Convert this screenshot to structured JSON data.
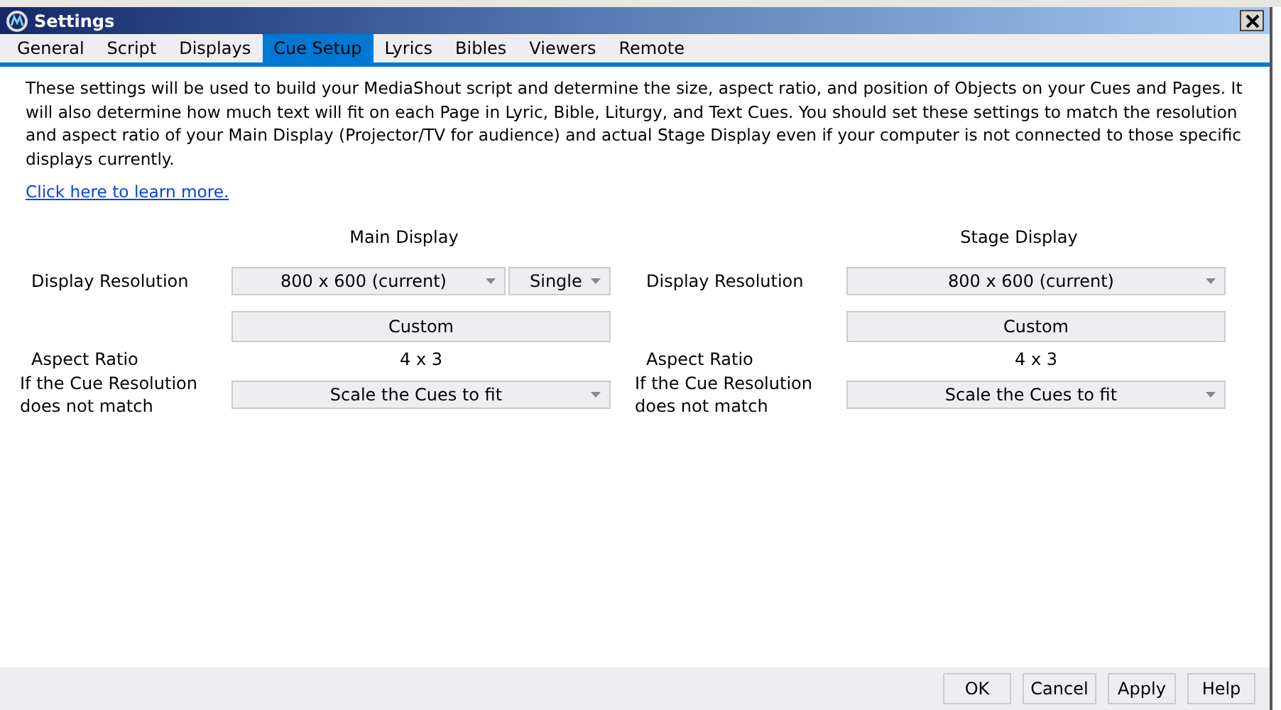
{
  "window": {
    "title": "Settings"
  },
  "tabs": [
    {
      "label": "General",
      "selected": false
    },
    {
      "label": "Script",
      "selected": false
    },
    {
      "label": "Displays",
      "selected": false
    },
    {
      "label": "Cue Setup",
      "selected": true
    },
    {
      "label": "Lyrics",
      "selected": false
    },
    {
      "label": "Bibles",
      "selected": false
    },
    {
      "label": "Viewers",
      "selected": false
    },
    {
      "label": "Remote",
      "selected": false
    }
  ],
  "description": "These settings will be used to build your MediaShout script and determine the size, aspect ratio, and position of Objects on your Cues and Pages. It will also determine how much text will fit on each Page in Lyric, Bible, Liturgy, and Text Cues. You should set these settings to match the resolution and aspect ratio of your Main Display (Projector/TV for audience) and actual Stage Display even if your computer is not connected to those specific displays currently.",
  "learn_more_link": "Click here to learn more.",
  "panels": [
    {
      "heading": "Main Display",
      "resolution_label": "Display Resolution",
      "resolution": "800 x 600 (current)",
      "mode": "Single",
      "custom_button": "Custom",
      "aspect_label": "Aspect Ratio",
      "aspect": "4 x 3",
      "mismatch_label": "If the Cue Resolution does not match",
      "mismatch": "Scale the Cues to fit"
    },
    {
      "heading": "Stage Display",
      "resolution_label": "Display Resolution",
      "resolution": "800 x 600 (current)",
      "custom_button": "Custom",
      "aspect_label": "Aspect Ratio",
      "aspect": "4 x 3",
      "mismatch_label": "If the Cue Resolution does not match",
      "mismatch": "Scale the Cues to fit"
    }
  ],
  "buttons": [
    "OK",
    "Cancel",
    "Apply",
    "Help"
  ]
}
